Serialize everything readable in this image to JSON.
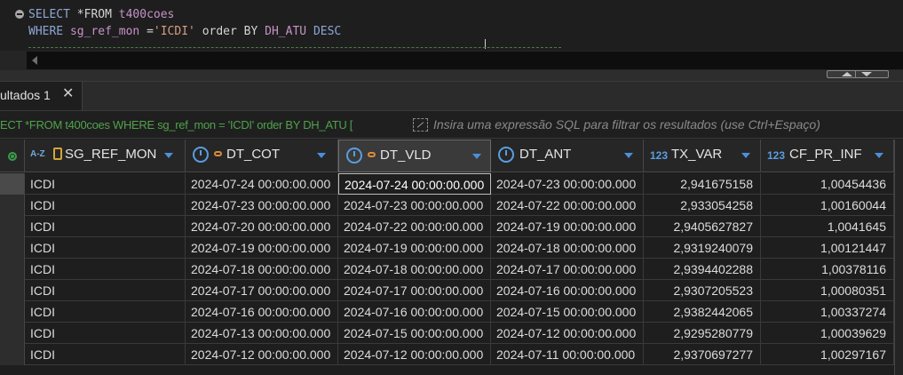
{
  "editor": {
    "line1": {
      "kw1": "SELECT",
      "rest1": " *FROM ",
      "table": "t400coes"
    },
    "line2": {
      "kw1": "WHERE",
      "space1": " ",
      "col": "sg_ref_mon",
      "op": " =",
      "val": "'ICDI'",
      "rest": " order BY ",
      "order_col": "DH_ATU",
      "kw_desc": " DESC"
    }
  },
  "results_tab": {
    "label": "ultados 1",
    "close_icon": "close-icon"
  },
  "filter": {
    "query_text": "ECT *FROM t400coes WHERE sg_ref_mon = 'ICDI' order BY DH_ATU [",
    "placeholder": "Insira uma expressão SQL para filtrar os resultados (use Ctrl+Espaço)"
  },
  "grid": {
    "columns": [
      {
        "name": "SG_REF_MON",
        "type_icon": "az-text-icon",
        "key": true
      },
      {
        "name": "DT_COT",
        "type_icon": "clock-icon",
        "key": true
      },
      {
        "name": "DT_VLD",
        "type_icon": "clock-icon",
        "key": true,
        "selected": true
      },
      {
        "name": "DT_ANT",
        "type_icon": "clock-icon",
        "key": false
      },
      {
        "name": "TX_VAR",
        "type_icon": "number-icon",
        "type_label": "123",
        "key": false
      },
      {
        "name": "CF_PR_INF",
        "type_icon": "number-icon",
        "type_label": "123",
        "key": false
      }
    ],
    "rows": [
      [
        "ICDI",
        "2024-07-24 00:00:00.000",
        "2024-07-24 00:00:00.000",
        "2024-07-23 00:00:00.000",
        "2,941675158",
        "1,00454436"
      ],
      [
        "ICDI",
        "2024-07-23 00:00:00.000",
        "2024-07-23 00:00:00.000",
        "2024-07-22 00:00:00.000",
        "2,933054258",
        "1,00160044"
      ],
      [
        "ICDI",
        "2024-07-20 00:00:00.000",
        "2024-07-22 00:00:00.000",
        "2024-07-19 00:00:00.000",
        "2,9405627827",
        "1,0041645"
      ],
      [
        "ICDI",
        "2024-07-19 00:00:00.000",
        "2024-07-19 00:00:00.000",
        "2024-07-18 00:00:00.000",
        "2,9319240079",
        "1,00121447"
      ],
      [
        "ICDI",
        "2024-07-18 00:00:00.000",
        "2024-07-18 00:00:00.000",
        "2024-07-17 00:00:00.000",
        "2,9394402288",
        "1,00378116"
      ],
      [
        "ICDI",
        "2024-07-17 00:00:00.000",
        "2024-07-17 00:00:00.000",
        "2024-07-16 00:00:00.000",
        "2,9307205523",
        "1,00080351"
      ],
      [
        "ICDI",
        "2024-07-16 00:00:00.000",
        "2024-07-16 00:00:00.000",
        "2024-07-15 00:00:00.000",
        "2,9382442065",
        "1,00337274"
      ],
      [
        "ICDI",
        "2024-07-13 00:00:00.000",
        "2024-07-15 00:00:00.000",
        "2024-07-12 00:00:00.000",
        "2,9295280779",
        "1,00039629"
      ],
      [
        "ICDI",
        "2024-07-12 00:00:00.000",
        "2024-07-12 00:00:00.000",
        "2024-07-11 00:00:00.000",
        "2,9370697277",
        "1,00297167"
      ]
    ]
  }
}
